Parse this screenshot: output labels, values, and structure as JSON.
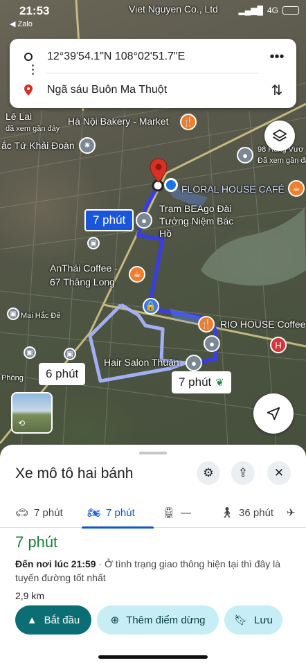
{
  "status_bar": {
    "time": "21:53",
    "back_app": "◀ Zalo",
    "network": "4G"
  },
  "route_card": {
    "origin": "12°39'54.1\"N 108°02'51.7\"E",
    "destination": "Ngã sáu Buôn Ma Thuột"
  },
  "map": {
    "labels": [
      "Viet Nguyen Co., Ltd",
      "Hà Nội Bakery - Market",
      "Lê Lai",
      "đã xem gần đây",
      "ắc Tứ Khải Đoàn",
      "98 Hùng Vươ",
      "Đã xem gần đây",
      "FLORAL HOUSE CAFÉ",
      "Trạm BEAgo Đài Tưởng Niệm Bác Hồ",
      "AnThái Coffee - 67 Thăng Long",
      "Mai Hắc Đế",
      "RIO HOUSE Coffee",
      "Hair Salon Thuận",
      "Phòng"
    ],
    "route_badges": {
      "selected": "7 phút",
      "alt1": "6 phút",
      "alt2": "7 phút"
    },
    "colors": {
      "selected_route": "#3a3fd9",
      "alt_route": "#a7b4ff",
      "destination_pin": "#d93025"
    }
  },
  "sheet": {
    "title": "Xe mô tô hai bánh",
    "modes": [
      {
        "icon": "car-icon",
        "label": "7 phút"
      },
      {
        "icon": "motorbike-icon",
        "label": "7 phút",
        "active": true
      },
      {
        "icon": "transit-icon",
        "label": "—"
      },
      {
        "icon": "walk-icon",
        "label": "36 phút"
      },
      {
        "icon": "flight-icon",
        "label": ""
      }
    ],
    "duration": "7 phút",
    "arrival_label": "Đến nơi lúc 21:59",
    "traffic_note": " · Ở tình trạng giao thông hiện tại thì đây là tuyến đường tốt nhất",
    "distance": "2,9 km",
    "buttons": {
      "start": "Bắt đầu",
      "add_stop": "Thêm điểm dừng",
      "save": "Lưu"
    }
  }
}
